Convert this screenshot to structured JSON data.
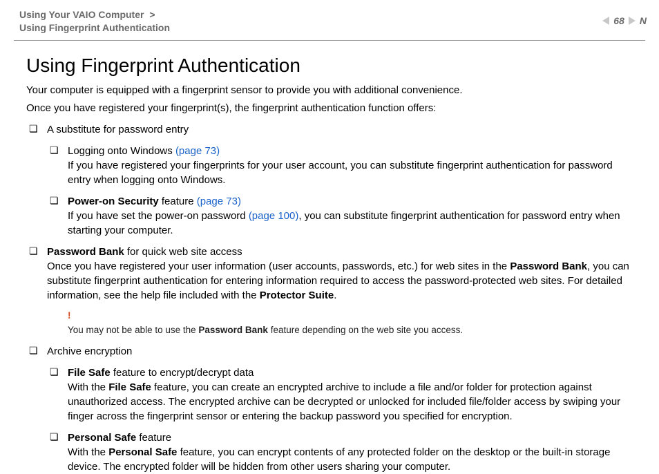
{
  "header": {
    "crumb1": "Using Your VAIO Computer",
    "gt": ">",
    "crumb2": "Using Fingerprint Authentication",
    "page_num": "68",
    "N": "N"
  },
  "title": "Using Fingerprint Authentication",
  "intro1": "Your computer is equipped with a fingerprint sensor to provide you with additional convenience.",
  "intro2": "Once you have registered your fingerprint(s), the fingerprint authentication function offers:",
  "b1": {
    "t": "A substitute for password entry",
    "s1_t1": "Logging onto Windows ",
    "s1_link": "(page 73)",
    "s1_body": "If you have registered your fingerprints for your user account, you can substitute fingerprint authentication for password entry when logging onto Windows.",
    "s2_bold": "Power-on Security",
    "s2_t2": " feature ",
    "s2_link": "(page 73)",
    "s2_body_a": "If you have set the power-on password ",
    "s2_body_link": "(page 100)",
    "s2_body_b": ", you can substitute fingerprint authentication for password entry when starting your computer."
  },
  "b2": {
    "bold": "Password Bank",
    "rest": " for quick web site access",
    "body_a": "Once you have registered your user information (user accounts, passwords, etc.) for web sites in the ",
    "body_b": "Password Bank",
    "body_c": ", you can substitute fingerprint authentication for entering information required to access the password-protected web sites. For detailed information, see the help file included with the ",
    "body_d": "Protector Suite",
    "body_e": "."
  },
  "note": {
    "bang": "!",
    "t_a": "You may not be able to use the ",
    "t_bold": "Password Bank",
    "t_b": " feature depending on the web site you access."
  },
  "b3": {
    "t": "Archive encryption",
    "s1_bold": "File Safe",
    "s1_rest": " feature to encrypt/decrypt data",
    "s1_body_a": "With the ",
    "s1_body_bold": "File Safe",
    "s1_body_b": " feature, you can create an encrypted archive to include a file and/or folder for protection against unauthorized access. The encrypted archive can be decrypted or unlocked for included file/folder access by swiping your finger across the fingerprint sensor or entering the backup password you specified for encryption.",
    "s2_bold": "Personal Safe",
    "s2_rest": " feature",
    "s2_body_a": "With the ",
    "s2_body_bold": "Personal Safe",
    "s2_body_b": " feature, you can encrypt contents of any protected folder on the desktop or the built-in storage device. The encrypted folder will be hidden from other users sharing your computer."
  }
}
